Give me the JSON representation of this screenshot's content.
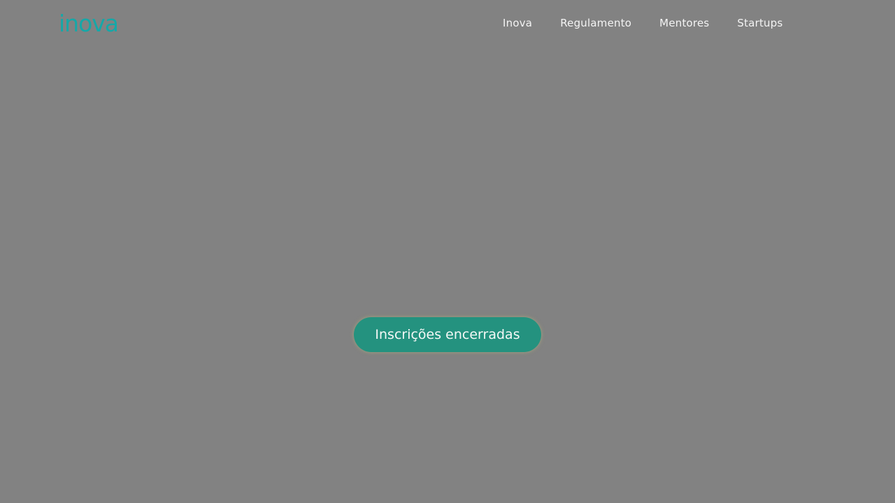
{
  "header": {
    "logo": {
      "text": "inova",
      "color": "#15a8a8"
    },
    "nav": [
      {
        "label": "Inova"
      },
      {
        "label": "Regulamento"
      },
      {
        "label": "Mentores"
      },
      {
        "label": "Startups"
      }
    ]
  },
  "main": {
    "cta_label": "Inscrições encerradas",
    "cta_color": "#24927f",
    "background_color": "#828282"
  }
}
